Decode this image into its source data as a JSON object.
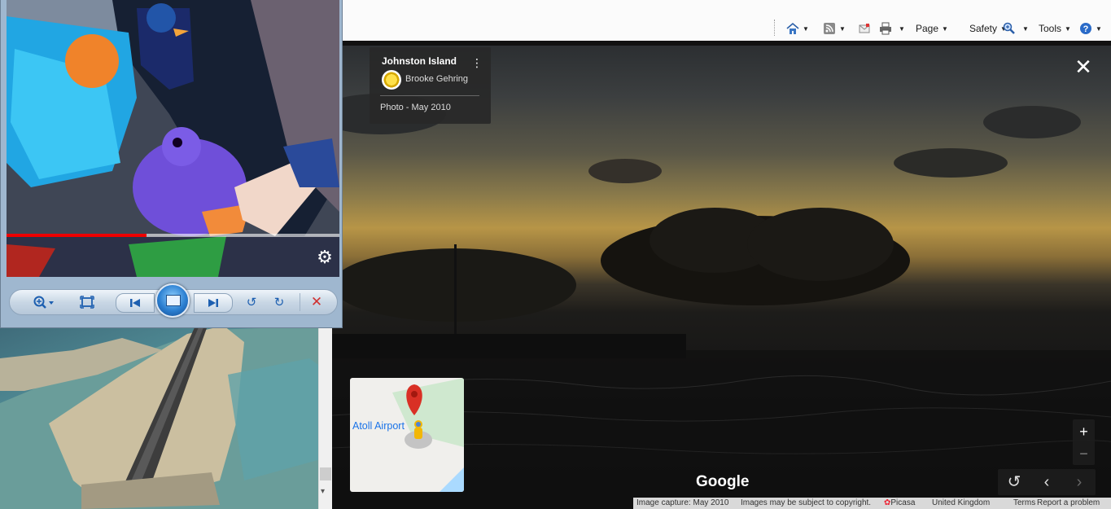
{
  "command_bar": {
    "items": [
      {
        "icon": "home-icon"
      },
      {
        "icon": "feeds-icon"
      },
      {
        "icon": "read-mail-icon"
      },
      {
        "icon": "print-icon"
      },
      {
        "label": "Page"
      },
      {
        "label": "Safety"
      },
      {
        "icon": "zoom-icon"
      },
      {
        "label": "Tools"
      },
      {
        "icon": "help-icon"
      }
    ]
  },
  "streetview": {
    "info_card": {
      "place": "Johnston Island",
      "author": "Brooke Gehring",
      "photo_date": "Photo - May 2010"
    },
    "minimap": {
      "label": "Atoll Airport"
    },
    "logo": "Google",
    "footer": {
      "capture": "Image capture: May 2010",
      "copyright": "Images may be subject to copyright.",
      "source": "Picasa",
      "region": "United Kingdom",
      "terms": "Terms",
      "report": "Report a problem"
    },
    "colors": {
      "sky_gold": "#b79547",
      "card_bg": "#282828",
      "map_pin": "#d93025",
      "map_link": "#1a73e8"
    }
  },
  "player": {
    "progress_fraction": 0.42,
    "controls": [
      "zoom-icon",
      "fit-window-icon",
      "previous-icon",
      "slideshow-icon",
      "next-icon",
      "rotate-left-icon",
      "rotate-right-icon",
      "delete-icon"
    ]
  }
}
